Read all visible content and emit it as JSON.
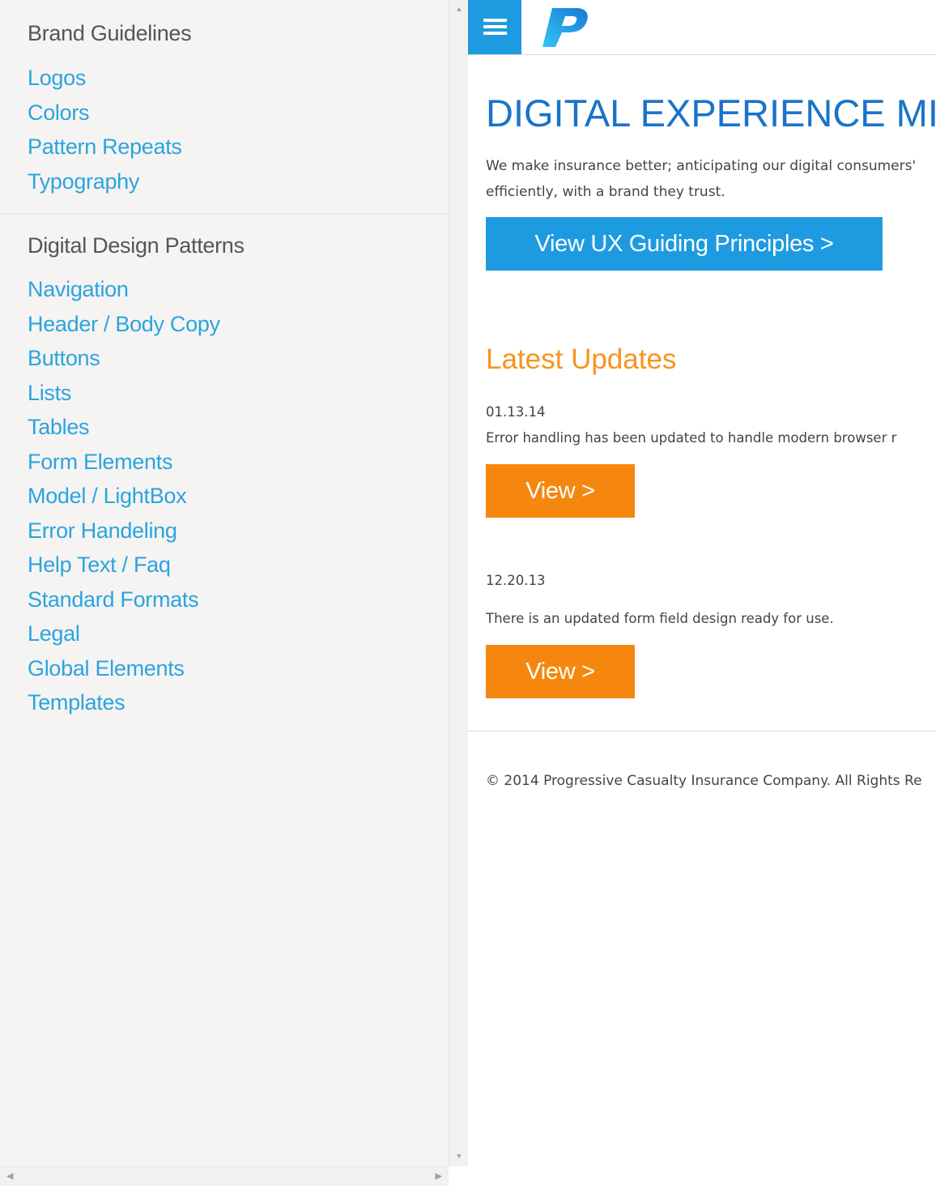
{
  "sidebar": {
    "brand_title": "Brand Guidelines",
    "brand_items": [
      "Logos",
      "Colors",
      "Pattern Repeats",
      "Typography"
    ],
    "digital_title": "Digital Design Patterns",
    "digital_items": [
      "Navigation",
      "Header / Body Copy",
      "Buttons",
      "Lists",
      "Tables",
      "Form Elements",
      "Model / LightBox",
      "Error Handeling",
      "Help Text / Faq",
      "Standard Formats",
      "Legal",
      "Global Elements",
      "Templates"
    ]
  },
  "header": {
    "menu_icon": "hamburger-menu-icon",
    "logo_icon": "progressive-p-logo"
  },
  "main": {
    "title": "DIGITAL EXPERIENCE MI",
    "intro_line1": "We make insurance better; anticipating our digital consumers'",
    "intro_line2": "efficiently, with a brand they trust.",
    "ux_button": "View UX Guiding Principles >",
    "updates_title": "Latest Updates",
    "updates": [
      {
        "date": "01.13.14",
        "text": "Error handling has been updated to handle modern browser r",
        "button": "View >"
      },
      {
        "date": "12.20.13",
        "text": "There is an updated form field design ready for use.",
        "button": "View >"
      }
    ],
    "footer": "© 2014 Progressive Casualty Insurance Company. All Rights Re"
  },
  "colors": {
    "accent_blue": "#1e9be0",
    "title_blue": "#1a73c9",
    "link_blue": "#2aa4e0",
    "accent_orange": "#f5870e",
    "updates_orange": "#f7941d"
  }
}
